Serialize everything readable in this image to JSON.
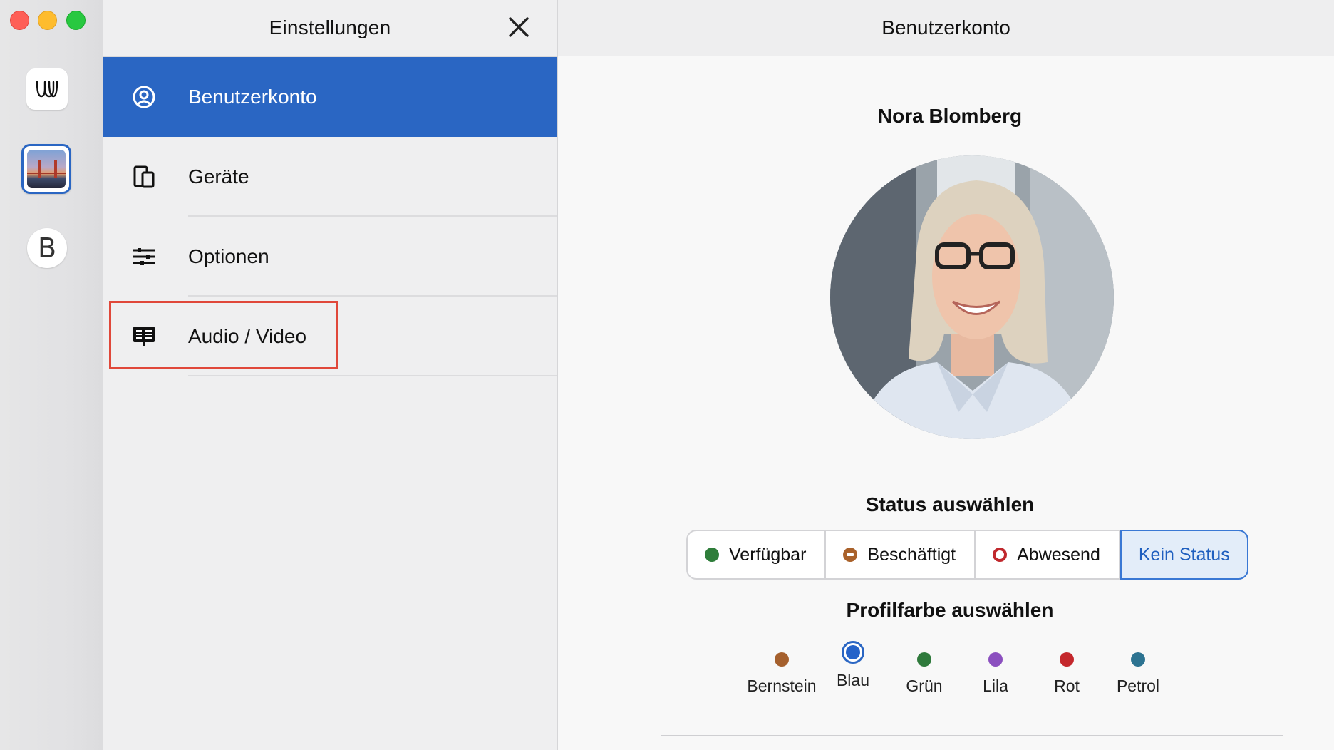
{
  "window": {
    "controls": [
      "close",
      "minimize",
      "zoom"
    ]
  },
  "rail": {
    "apps": [
      {
        "name": "wire-app",
        "glyph": "W"
      },
      {
        "name": "photo-account",
        "selected": true
      },
      {
        "name": "b-account",
        "glyph": "B"
      }
    ]
  },
  "settings": {
    "title": "Einstellungen",
    "items": [
      {
        "label": "Benutzerkonto",
        "icon": "user-circle-icon",
        "active": true
      },
      {
        "label": "Geräte",
        "icon": "devices-icon"
      },
      {
        "label": "Optionen",
        "icon": "sliders-icon"
      },
      {
        "label": "Audio / Video",
        "icon": "monitor-list-icon",
        "highlighted": true
      }
    ]
  },
  "main": {
    "title": "Benutzerkonto",
    "profile_name": "Nora Blomberg",
    "status_title": "Status auswählen",
    "status_options": [
      {
        "label": "Verfügbar",
        "color": "#2e7d3a",
        "icon": "available-dot-icon"
      },
      {
        "label": "Beschäftigt",
        "color": "#a9612a",
        "icon": "busy-dot-icon"
      },
      {
        "label": "Abwesend",
        "color": "#c0282d",
        "icon": "away-ring-icon"
      },
      {
        "label": "Kein Status",
        "selected": true
      }
    ],
    "color_title": "Profilfarbe auswählen",
    "colors": [
      {
        "label": "Bernstein",
        "hex": "#a5602d"
      },
      {
        "label": "Blau",
        "hex": "#2563c9",
        "selected": true
      },
      {
        "label": "Grün",
        "hex": "#2f7a3c"
      },
      {
        "label": "Lila",
        "hex": "#8b4fbf"
      },
      {
        "label": "Rot",
        "hex": "#c4272c"
      },
      {
        "label": "Petrol",
        "hex": "#2d7391"
      }
    ]
  },
  "theme": {
    "accent": "#2a66c3",
    "highlight_border": "#e0483a"
  }
}
